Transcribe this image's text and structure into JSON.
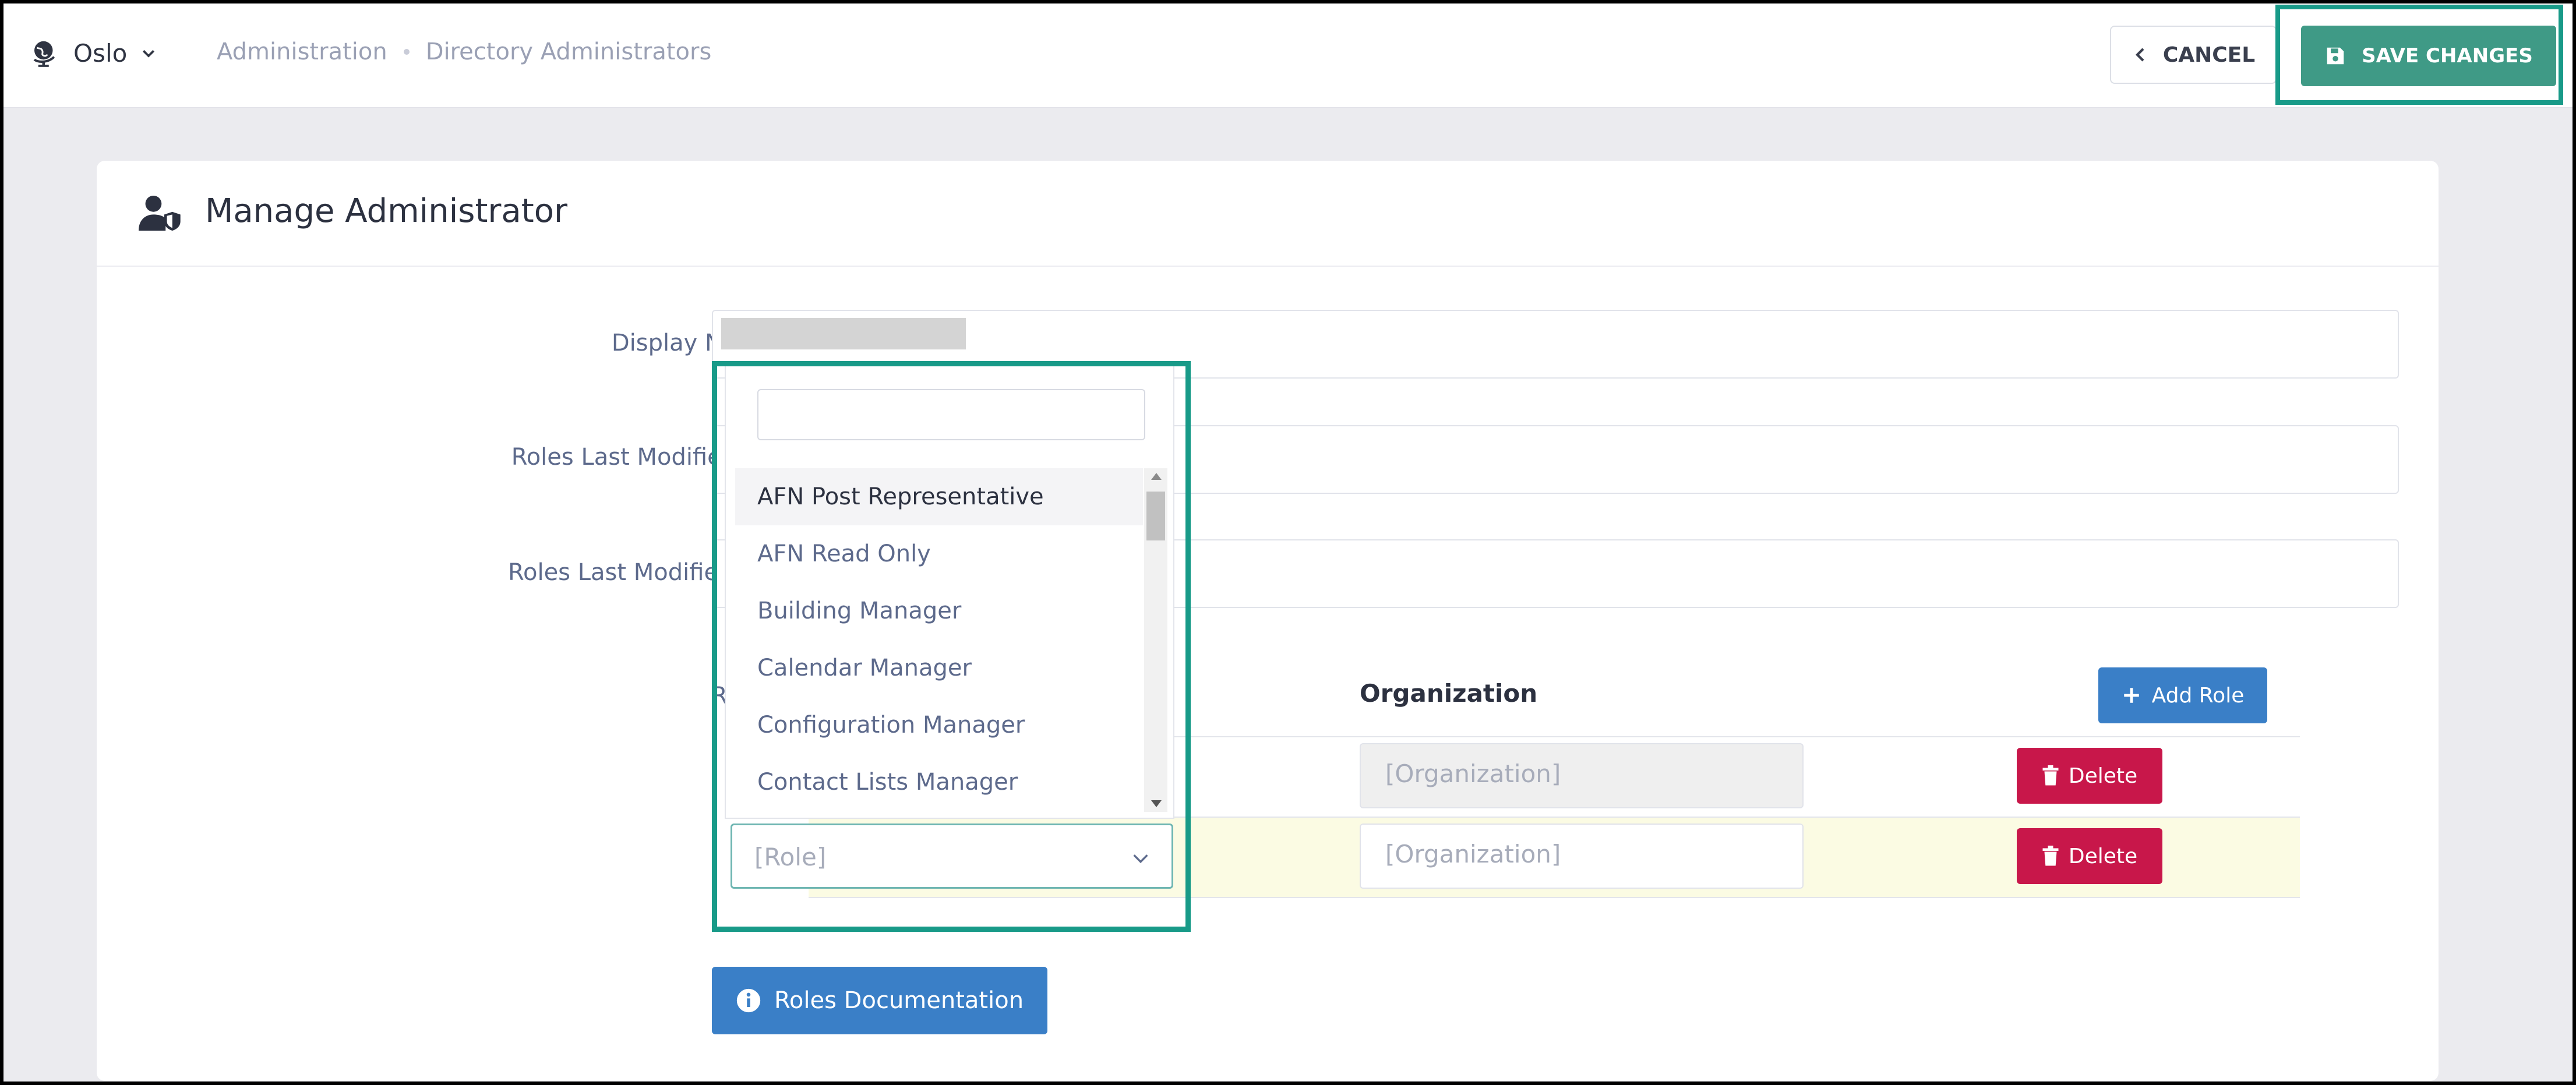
{
  "header": {
    "org_name": "Oslo",
    "breadcrumb": [
      "Administration",
      "Directory Administrators"
    ],
    "cancel_label": "CANCEL",
    "save_label": "SAVE CHANGES",
    "save_color": "#3f9a86",
    "highlight_color": "#189a88"
  },
  "card": {
    "title": "Manage Administrator",
    "fields": {
      "display_name_label": "Display Name",
      "roles_modified_by_label": "Roles Last Modified By",
      "roles_modified_on_label": "Roles Last Modified On",
      "roles_label": "Roles"
    },
    "roles_table": {
      "organization_header": "Organization",
      "add_role_label": "Add Role",
      "rows": [
        {
          "organization_placeholder": "[Organization]",
          "delete_label": "Delete"
        },
        {
          "role_placeholder": "[Role]",
          "organization_placeholder": "[Organization]",
          "delete_label": "Delete"
        }
      ]
    },
    "docs_button_label": "Roles Documentation"
  },
  "role_dropdown": {
    "search_value": "",
    "options": [
      "AFN Post Representative",
      "AFN Read Only",
      "Building Manager",
      "Calendar Manager",
      "Configuration Manager",
      "Contact Lists Manager"
    ],
    "highlighted_option": "AFN Post Representative"
  }
}
